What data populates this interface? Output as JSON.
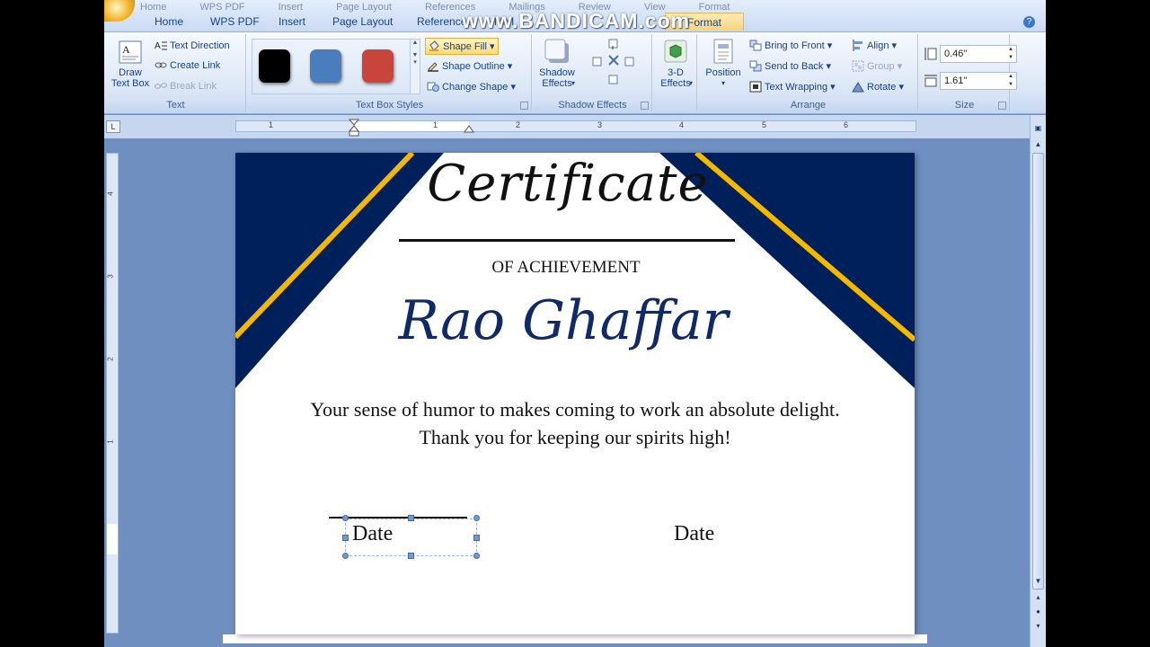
{
  "watermark": "www.BANDICAM.com",
  "ghost_tabs": [
    "Home",
    "WPS PDF",
    "Insert",
    "Page Layout",
    "References",
    "Mailings",
    "Review",
    "View",
    "Format"
  ],
  "tabs": [
    "Home",
    "WPS PDF",
    "Insert",
    "Page Layout",
    "References",
    "Mail"
  ],
  "context_tab": "Format",
  "ribbon": {
    "text_group": {
      "label": "Text",
      "draw_text_box": "Draw Text Box",
      "text_direction": "Text Direction",
      "create_link": "Create Link",
      "break_link": "Break Link"
    },
    "text_box_styles": {
      "label": "Text Box Styles",
      "swatch_colors": [
        "#000000",
        "#4a7dbd",
        "#c9453c"
      ],
      "shape_fill": "Shape Fill",
      "shape_outline": "Shape Outline",
      "change_shape": "Change Shape"
    },
    "shadow_effects": {
      "label": "Shadow Effects",
      "button": "Shadow Effects"
    },
    "three_d": {
      "button": "3-D Effects"
    },
    "arrange": {
      "label": "Arrange",
      "position": "Position",
      "bring_to_front": "Bring to Front",
      "send_to_back": "Send to Back",
      "text_wrapping": "Text Wrapping",
      "align": "Align",
      "group": "Group",
      "rotate": "Rotate"
    },
    "size": {
      "label": "Size",
      "height": "0.46\"",
      "width": "1.61\""
    }
  },
  "ruler_numbers": [
    "1",
    "1",
    "2",
    "3",
    "4",
    "5",
    "6"
  ],
  "vruler_numbers": [
    "4",
    "3",
    "2",
    "1"
  ],
  "certificate": {
    "title": "Certificate",
    "subtitle": "OF ACHIEVEMENT",
    "recipient": "Rao Ghaffar",
    "message_line1": "Your sense of humor to makes coming to work an absolute delight.",
    "message_line2": "Thank you for keeping our spirits high!",
    "date_left": "Date",
    "date_right": "Date",
    "colors": {
      "navy": "#00205b",
      "gold": "#f4b800"
    }
  }
}
